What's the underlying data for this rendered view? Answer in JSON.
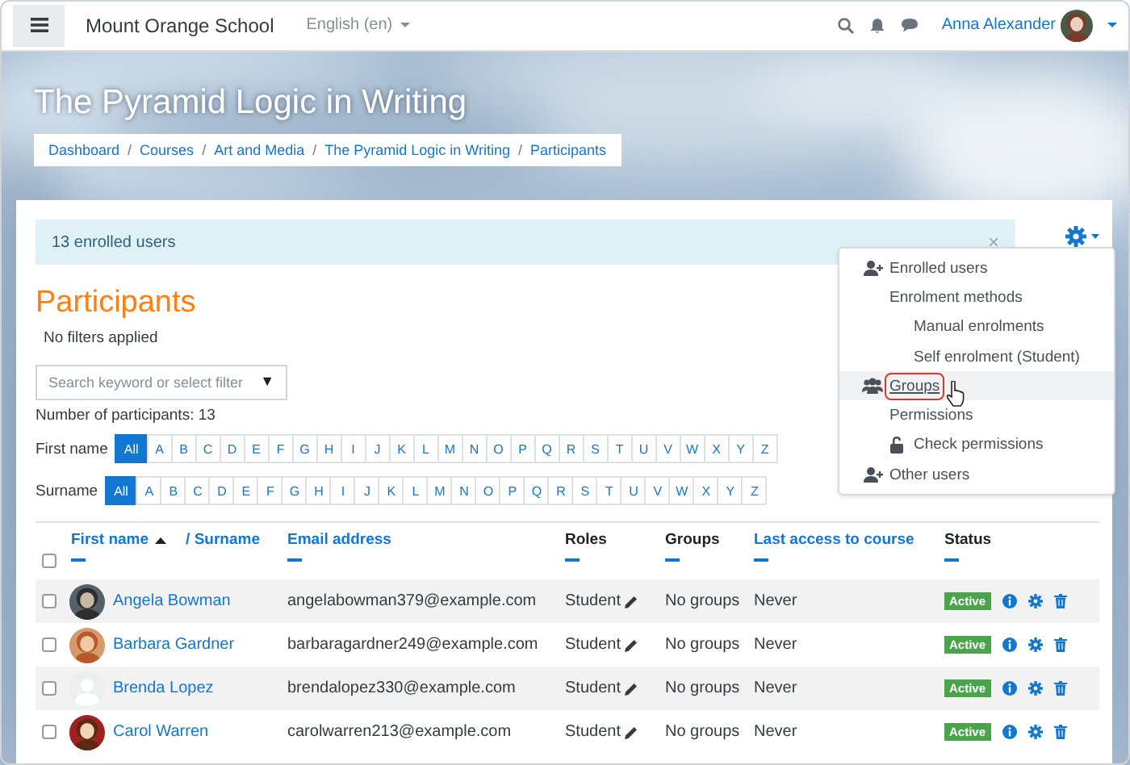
{
  "navbar": {
    "site_name": "Mount Orange School",
    "language": "English (en)",
    "user_name": "Anna Alexander"
  },
  "header": {
    "title": "The Pyramid Logic in Writing",
    "breadcrumb": [
      {
        "label": "Dashboard",
        "separator": "/"
      },
      {
        "label": "Courses",
        "separator": "/"
      },
      {
        "label": "Art and Media",
        "separator": "/"
      },
      {
        "label": "The Pyramid Logic in Writing",
        "separator": "/"
      },
      {
        "label": "Participants"
      }
    ]
  },
  "alert": {
    "text": "13 enrolled users",
    "close": "×"
  },
  "settings_menu": [
    {
      "label": "Enrolled users",
      "kind": "adduser",
      "selected": false
    },
    {
      "label": "Enrolment methods",
      "kind": "plain",
      "selected": false,
      "children": [
        {
          "label": "Manual enrolments",
          "kind": "plain",
          "selected": false
        },
        {
          "label": "Self enrolment (Student)",
          "kind": "plain",
          "selected": false
        }
      ]
    },
    {
      "label": "Groups",
      "kind": "group",
      "selected": true
    },
    {
      "label": "Permissions",
      "kind": "plain",
      "selected": false,
      "children": [
        {
          "label": "Check permissions",
          "kind": "lock",
          "selected": false
        }
      ]
    },
    {
      "label": "Other users",
      "kind": "adduser",
      "selected": false
    }
  ],
  "page_title": "Participants",
  "filter_status": "No filters applied",
  "search": {
    "placeholder": "Search keyword or select filter",
    "caret": "▼"
  },
  "participant_count": "Number of participants: 13",
  "initials_filters": [
    {
      "label": "First name",
      "letters": [
        {
          "label": "All",
          "selected": true
        },
        {
          "label": "A",
          "selected": false
        },
        {
          "label": "B",
          "selected": false
        },
        {
          "label": "C",
          "selected": false
        },
        {
          "label": "D",
          "selected": false
        },
        {
          "label": "E",
          "selected": false
        },
        {
          "label": "F",
          "selected": false
        },
        {
          "label": "G",
          "selected": false
        },
        {
          "label": "H",
          "selected": false
        },
        {
          "label": "I",
          "selected": false
        },
        {
          "label": "J",
          "selected": false
        },
        {
          "label": "K",
          "selected": false
        },
        {
          "label": "L",
          "selected": false
        },
        {
          "label": "M",
          "selected": false
        },
        {
          "label": "N",
          "selected": false
        },
        {
          "label": "O",
          "selected": false
        },
        {
          "label": "P",
          "selected": false
        },
        {
          "label": "Q",
          "selected": false
        },
        {
          "label": "R",
          "selected": false
        },
        {
          "label": "S",
          "selected": false
        },
        {
          "label": "T",
          "selected": false
        },
        {
          "label": "U",
          "selected": false
        },
        {
          "label": "V",
          "selected": false
        },
        {
          "label": "W",
          "selected": false
        },
        {
          "label": "X",
          "selected": false
        },
        {
          "label": "Y",
          "selected": false
        },
        {
          "label": "Z",
          "selected": false
        }
      ]
    },
    {
      "label": "Surname",
      "letters": [
        {
          "label": "All",
          "selected": true
        },
        {
          "label": "A",
          "selected": false
        },
        {
          "label": "B",
          "selected": false
        },
        {
          "label": "C",
          "selected": false
        },
        {
          "label": "D",
          "selected": false
        },
        {
          "label": "E",
          "selected": false
        },
        {
          "label": "F",
          "selected": false
        },
        {
          "label": "G",
          "selected": false
        },
        {
          "label": "H",
          "selected": false
        },
        {
          "label": "I",
          "selected": false
        },
        {
          "label": "J",
          "selected": false
        },
        {
          "label": "K",
          "selected": false
        },
        {
          "label": "L",
          "selected": false
        },
        {
          "label": "M",
          "selected": false
        },
        {
          "label": "N",
          "selected": false
        },
        {
          "label": "O",
          "selected": false
        },
        {
          "label": "P",
          "selected": false
        },
        {
          "label": "Q",
          "selected": false
        },
        {
          "label": "R",
          "selected": false
        },
        {
          "label": "S",
          "selected": false
        },
        {
          "label": "T",
          "selected": false
        },
        {
          "label": "U",
          "selected": false
        },
        {
          "label": "V",
          "selected": false
        },
        {
          "label": "W",
          "selected": false
        },
        {
          "label": "X",
          "selected": false
        },
        {
          "label": "Y",
          "selected": false
        },
        {
          "label": "Z",
          "selected": false
        }
      ]
    }
  ],
  "table": {
    "select_all": {
      "checked": false
    },
    "columns": [
      {
        "label": "First name",
        "sortable": true,
        "sorted": true
      },
      {
        "label": "/ Surname",
        "sortable": true,
        "sorted": false
      },
      {
        "label": "Email address",
        "sortable": true,
        "sorted": false
      },
      {
        "label": "Roles",
        "sortable": false,
        "sorted": false
      },
      {
        "label": "Groups",
        "sortable": false,
        "sorted": false
      },
      {
        "label": "Last access to course",
        "sortable": true,
        "sorted": false
      },
      {
        "label": "Status",
        "sortable": false,
        "sorted": false
      }
    ],
    "rows": [
      {
        "checked": false,
        "has_photo": true,
        "name": "Angela Bowman",
        "email": "angelabowman379@example.com",
        "role": "Student",
        "groups": "No groups",
        "last_access": "Never",
        "status": "Active"
      },
      {
        "checked": false,
        "has_photo": true,
        "name": "Barbara Gardner",
        "email": "barbaragardner249@example.com",
        "role": "Student",
        "groups": "No groups",
        "last_access": "Never",
        "status": "Active"
      },
      {
        "checked": false,
        "has_photo": false,
        "name": "Brenda Lopez",
        "email": "brendalopez330@example.com",
        "role": "Student",
        "groups": "No groups",
        "last_access": "Never",
        "status": "Active"
      },
      {
        "checked": false,
        "has_photo": true,
        "name": "Carol Warren",
        "email": "carolwarren213@example.com",
        "role": "Student",
        "groups": "No groups",
        "last_access": "Never",
        "status": "Active"
      }
    ]
  }
}
